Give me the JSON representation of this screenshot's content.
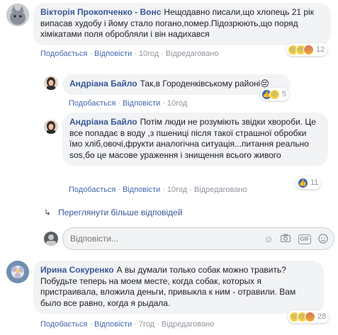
{
  "comments": [
    {
      "author": "Вікторія Прокопченко - Вонс",
      "text": "Нещодавно писали,що хлопець 21 рік випасав худобу і йому стало погано,помер.Підозрюють,що поряд хімікатами поля обробляли і він надихався",
      "like": "Подобається",
      "reply": "Відповісти",
      "time": "10год",
      "edited": "Відредаговано",
      "reactions": "12"
    },
    {
      "author": "Андріана Байло",
      "text": "Так,в Городенківському районі😔",
      "like": "Подобається",
      "reply": "Відповісти",
      "time": "10год",
      "reactions": "5"
    },
    {
      "author": "Андріана Байло",
      "text": "Потім люди не розуміють звідки хвороби. Це все попадає в воду ,з пшениці після такої страшної обробки їмо хліб,овочі,фрукти аналогічна ситуація...питання реально sos,бо це масове ураження і знищення всього живого",
      "like": "Подобається",
      "reply": "Відповісти",
      "time": "10год",
      "edited": "Відредаговано",
      "reactions": "11"
    },
    {
      "author": "Ирина Сокуренко",
      "text": "А вы думали только собак можно травить? Побудьте теперь на моем месте, когда собак, которых я пристраивала, вложила деньги, привыкла к ним - отравили. Вам было все равно, когда я рыдала.",
      "like": "Подобається",
      "reply": "Відповісти",
      "time": "7год",
      "edited": "Відредаговано",
      "reactions": "28"
    }
  ],
  "more_replies": "Переглянути більше відповідей",
  "reply_box": {
    "placeholder": "Відповісти..."
  },
  "colors": {
    "link": "#385898",
    "action": "#4267b2",
    "bubble": "#f2f3f5"
  }
}
